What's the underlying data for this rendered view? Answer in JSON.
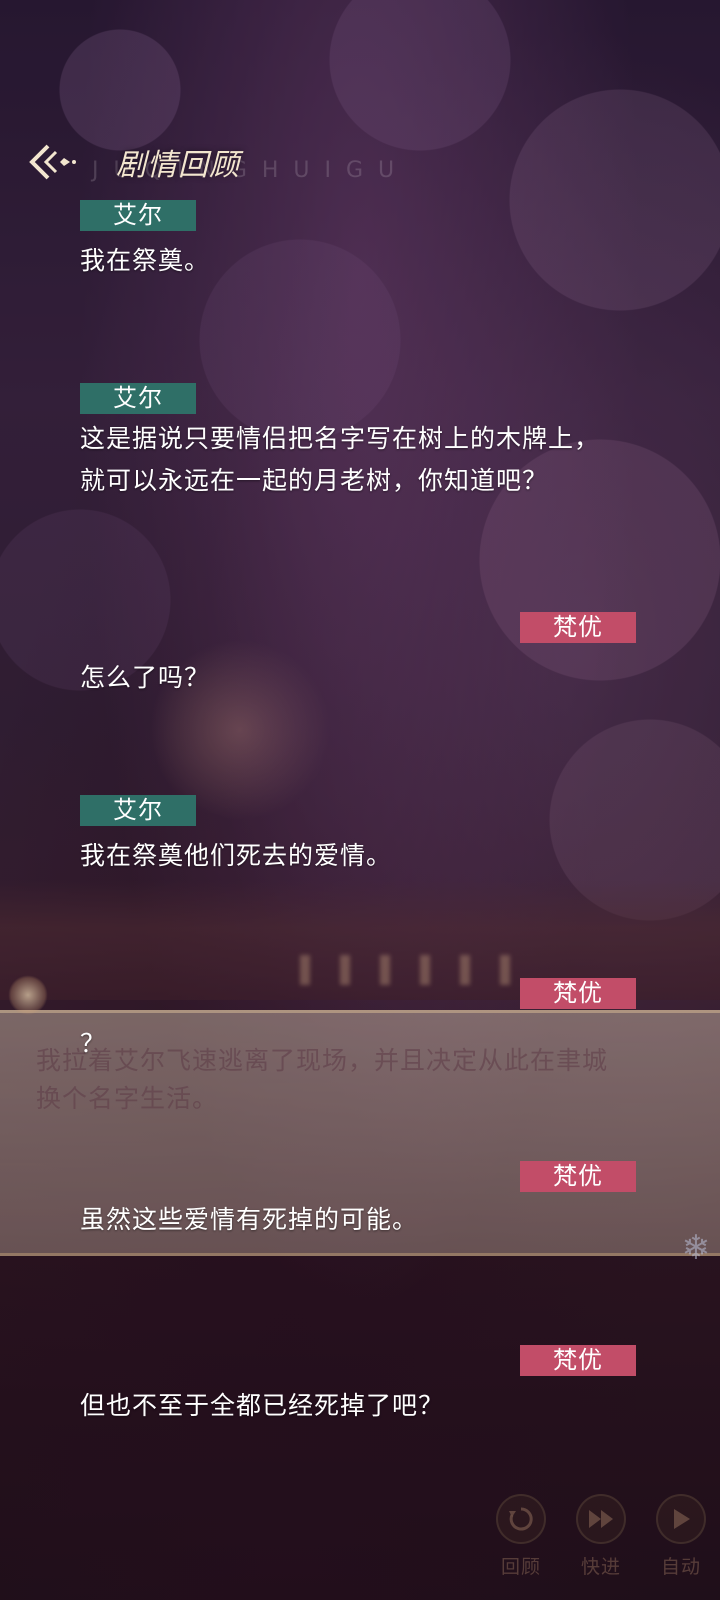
{
  "header": {
    "title": "剧情回顾",
    "subtitle": "J U Q I N G H U I G U"
  },
  "dialogue": [
    {
      "speaker": "艾尔",
      "side": "left",
      "lines": [
        "我在祭奠。"
      ]
    },
    {
      "speaker": "艾尔",
      "side": "left",
      "lines": [
        "这是据说只要情侣把名字写在树上的木牌上，",
        "就可以永远在一起的月老树，你知道吧？"
      ]
    },
    {
      "speaker": "梵优",
      "side": "right",
      "lines": [
        "怎么了吗？"
      ]
    },
    {
      "speaker": "艾尔",
      "side": "left",
      "lines": [
        "我在祭奠他们死去的爱情。"
      ]
    },
    {
      "speaker": "梵优",
      "side": "right",
      "lines": [
        "？"
      ]
    },
    {
      "speaker": "梵优",
      "side": "right",
      "lines": [
        "虽然这些爱情有死掉的可能。"
      ]
    },
    {
      "speaker": "梵优",
      "side": "right",
      "lines": [
        "但也不至于全都已经死掉了吧？"
      ]
    }
  ],
  "narration": {
    "lines": [
      "我拉着艾尔飞速逃离了现场，并且决定从此在聿城",
      "换个名字生活。"
    ]
  },
  "controls": [
    {
      "label": "回顾",
      "icon": "review-icon"
    },
    {
      "label": "快进",
      "icon": "fast-forward-icon"
    },
    {
      "label": "自动",
      "icon": "auto-play-icon"
    }
  ],
  "colors": {
    "left_speaker_tag": "#2f6f67",
    "right_speaker_tag": "#c24d68",
    "title": "#f3e6cf"
  }
}
